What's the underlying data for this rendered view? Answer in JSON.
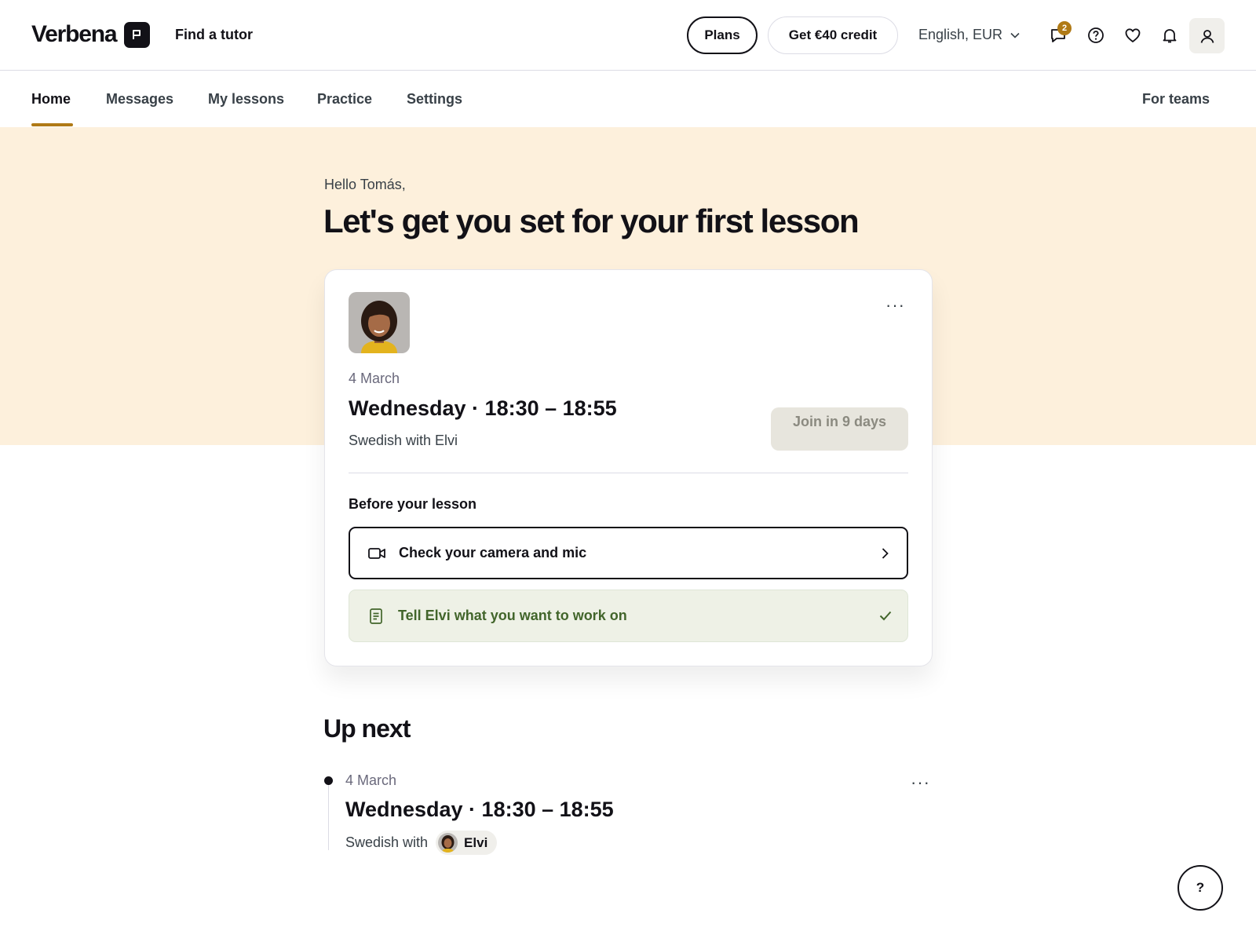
{
  "header": {
    "logo_text": "Verbena",
    "find_tutor": "Find a tutor",
    "plans_label": "Plans",
    "credit_label": "Get €40 credit",
    "language_currency": "English, EUR",
    "messages_badge_count": "2",
    "icons": [
      "messages-icon",
      "help-icon",
      "favorites-icon",
      "notifications-icon",
      "profile-icon"
    ]
  },
  "nav": {
    "items": [
      {
        "label": "Home",
        "active": true
      },
      {
        "label": "Messages"
      },
      {
        "label": "My lessons"
      },
      {
        "label": "Practice"
      },
      {
        "label": "Settings"
      }
    ],
    "for_teams": "For teams"
  },
  "hero": {
    "greeting": "Hello Tomás,",
    "headline": "Let's get you set for your first lesson"
  },
  "lesson_card": {
    "menu": "···",
    "date": "4 March",
    "time": "Wednesday · 18:30 – 18:55",
    "subject": "Swedish with Elvi",
    "join_label": "Join in 9 days",
    "before_title": "Before your lesson",
    "tasks": [
      {
        "label": "Check your camera and mic",
        "icon": "video-camera-icon",
        "status": "chevron-right-icon"
      },
      {
        "label": "Tell Elvi what you want to work on",
        "icon": "document-icon",
        "status": "checkmark-icon"
      }
    ]
  },
  "up_next": {
    "title": "Up next",
    "items": [
      {
        "date": "4 March",
        "time": "Wednesday · 18:30 – 18:55",
        "subject_prefix": "Swedish with",
        "tutor_name": "Elvi",
        "menu": "···"
      }
    ]
  },
  "help_fab_label": "?",
  "colors": {
    "accent": "#b07a16",
    "hero_background": "#fdf0dc",
    "success_text": "#42652b",
    "success_background": "#eef1e6"
  }
}
